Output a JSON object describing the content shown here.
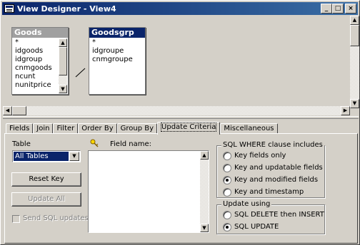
{
  "window": {
    "title": "View Designer - View4",
    "buttons": [
      "_",
      "□",
      "×"
    ]
  },
  "tables": [
    {
      "name": "Goods",
      "fields": [
        "*",
        "idgoods",
        "idgroup",
        "cnmgoods",
        "ncunt",
        "nunitprice"
      ]
    },
    {
      "name": "Goodsgrp",
      "fields": [
        "*",
        "idgroupe",
        "cnmgroupe"
      ]
    }
  ],
  "tabs": [
    "Fields",
    "Join",
    "Filter",
    "Order By",
    "Group By",
    "Update Criteria",
    "Miscellaneous"
  ],
  "active_tab": "Update Criteria",
  "update_criteria": {
    "table_label": "Table",
    "table_value": "All Tables",
    "reset_key": "Reset Key",
    "update_all": "Update All",
    "send_sql_updates": "Send SQL updates",
    "field_name_label": "Field name:",
    "where_group": {
      "title": "SQL WHERE clause includes",
      "options": [
        "Key fields only",
        "Key and updatable fields",
        "Key and modified fields",
        "Key and timestamp"
      ],
      "selected_index": 2
    },
    "update_group": {
      "title": "Update using",
      "options": [
        "SQL DELETE then INSERT",
        "SQL UPDATE"
      ],
      "selected_index": 1
    }
  }
}
